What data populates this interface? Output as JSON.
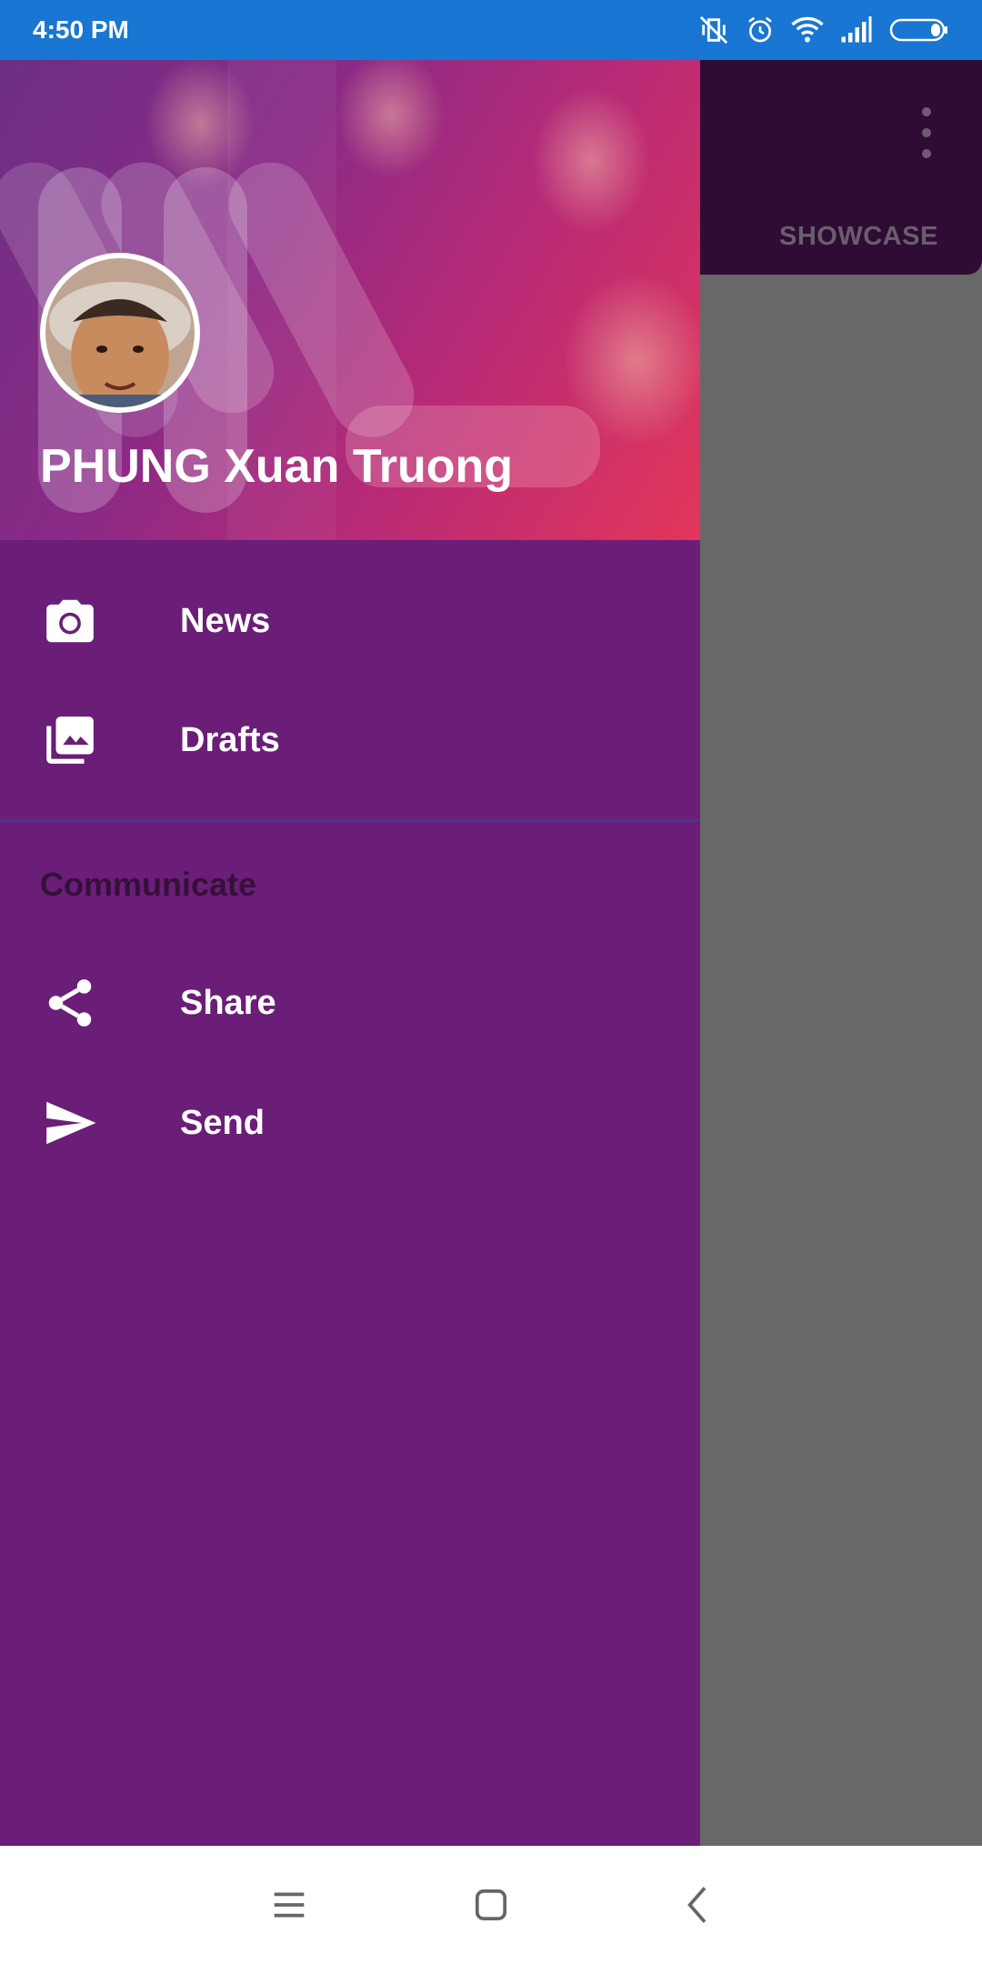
{
  "status_bar": {
    "time": "4:50 PM",
    "icons": [
      "vibrate-off-icon",
      "alarm-icon",
      "wifi-icon",
      "signal-icon",
      "battery-icon"
    ]
  },
  "background_app": {
    "overflow_icon": "overflow-menu-icon",
    "tab_label": "SHOWCASE"
  },
  "drawer": {
    "header": {
      "user_name": "PHUNG Xuan Truong"
    },
    "items": [
      {
        "label": "News",
        "icon": "camera-icon"
      },
      {
        "label": "Drafts",
        "icon": "photo-library-icon"
      }
    ],
    "section_title": "Communicate",
    "section_items": [
      {
        "label": "Share",
        "icon": "share-icon"
      },
      {
        "label": "Send",
        "icon": "send-icon"
      }
    ]
  },
  "nav_bar": {
    "buttons": [
      "recents-icon",
      "home-icon",
      "back-icon"
    ]
  },
  "colors": {
    "status_bar": "#1976d2",
    "drawer_bg": "#6a1e78",
    "scrim": "#686868",
    "appbar": "#2e0c33",
    "section_title": "#351038"
  }
}
